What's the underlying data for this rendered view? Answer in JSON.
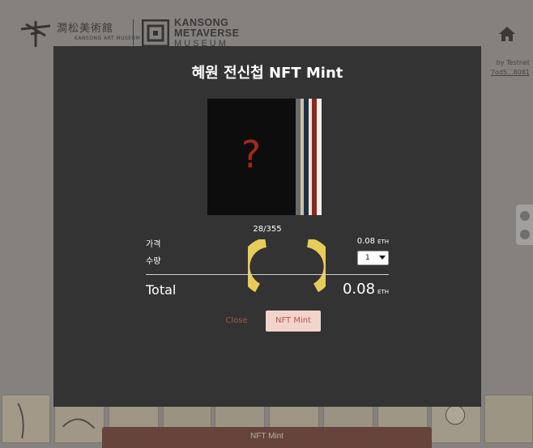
{
  "header": {
    "logo_kansong_text": "澗松美術館",
    "logo_kansong_sub": "KANSONG ART MUSEUM",
    "logo_meta_line1": "KANSONG",
    "logo_meta_line2": "METAVERSE",
    "logo_meta_line3": "MUSEUM",
    "home_icon": "home-icon"
  },
  "network": {
    "name": "by Testnet",
    "address": "7od5...8081"
  },
  "side_buttons": [
    "discord-icon",
    "download-icon"
  ],
  "modal": {
    "title": "혜원 전신첩 NFT Mint",
    "preview_symbol": "?",
    "supply": "28/355",
    "price_label": "가격",
    "price_value": "0.08",
    "price_unit": "ETH",
    "qty_label": "수량",
    "qty_selected": "1",
    "total_label": "Total",
    "total_value": "0.08",
    "total_unit": "ETH",
    "close_label": "Close",
    "mint_label": "NFT Mint"
  },
  "bottom": {
    "mint_label": "NFT Mint"
  },
  "colors": {
    "modal_bg": "#333333",
    "accent": "#a3281c",
    "spinner": "#e8cc5a",
    "mint_button_bg": "#f2d4cd",
    "mint_button_text": "#b2574a"
  }
}
